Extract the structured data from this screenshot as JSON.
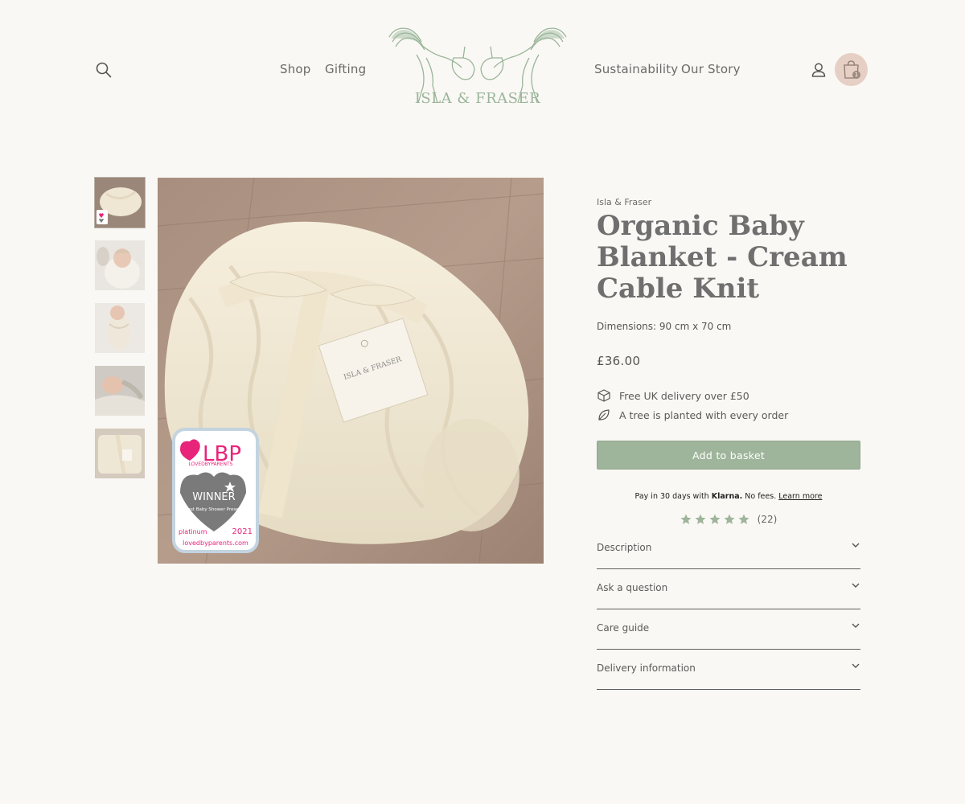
{
  "header": {
    "nav_left": [
      "Shop",
      "Gifting"
    ],
    "nav_right": [
      "Sustainability",
      "Our Story"
    ],
    "logo_text": "ISLA & FRASER",
    "cart_count": "1",
    "icons": {
      "search": "search-icon",
      "account": "account-icon",
      "cart": "shopping-bag-icon"
    }
  },
  "gallery": {
    "thumbnail_count": 5,
    "badge": {
      "brand": "LBP",
      "brand_sub": "LOVEDBYPARENTS",
      "award": "WINNER",
      "category": "Best Baby Shower Present",
      "tier": "platinum",
      "year": "2021",
      "site": "lovedbyparents.com"
    }
  },
  "product": {
    "vendor": "Isla & Fraser",
    "title": "Organic Baby Blanket - Cream Cable Knit",
    "dimensions": "Dimensions: 90 cm x 70 cm",
    "price": "£36.00",
    "perks": [
      "Free UK delivery over £50",
      "A tree is planted with every order"
    ],
    "add_to_basket": "Add to basket",
    "klarna": {
      "prefix": "Pay in 30 days with",
      "brand": "Klarna.",
      "suffix": "No fees.",
      "link": "Learn more"
    },
    "rating": {
      "stars": 5,
      "count": "(22)"
    },
    "accordion": [
      "Description",
      "Ask a question",
      "Care guide",
      "Delivery information"
    ]
  },
  "colors": {
    "accent_green": "#9fb59b",
    "cart_bg": "#e6cfc4",
    "badge_pink": "#e8237a",
    "background": "#faf8f4"
  }
}
